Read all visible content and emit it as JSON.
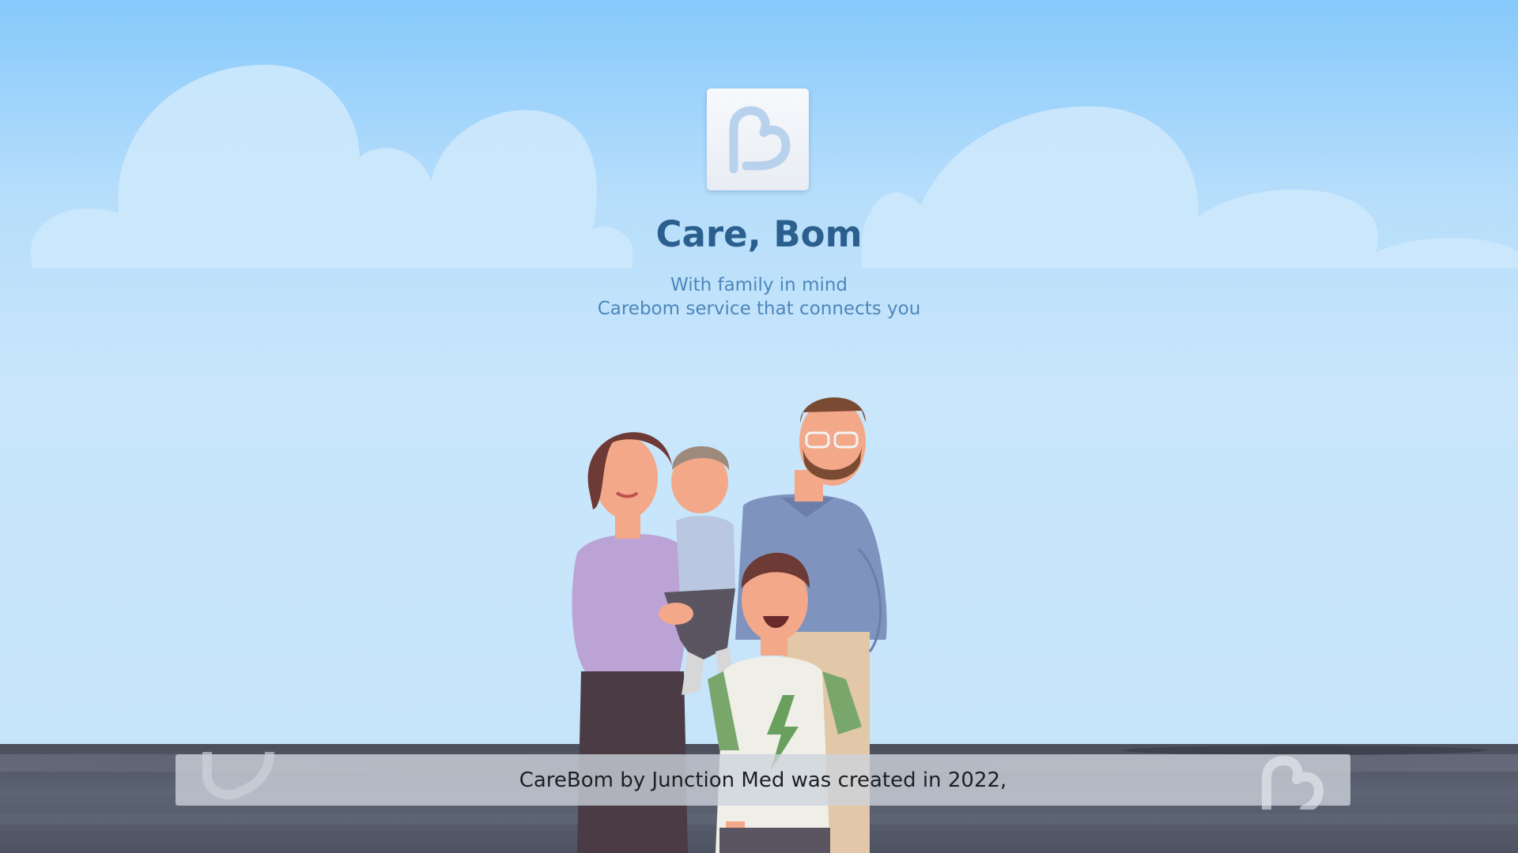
{
  "brand": {
    "logo_icon": "carebom-logo-icon",
    "title": "Care, Bom",
    "tagline_line1": "With family in mind",
    "tagline_line2": "Carebom service that connects you"
  },
  "illustration": {
    "subject": "family-illustration-icon"
  },
  "caption": {
    "text": "CareBom by Junction Med was created in 2022,"
  },
  "colors": {
    "sky_top": "#86c9fb",
    "sky_bottom": "#c6e4fa",
    "title": "#2a5f8e",
    "tagline": "#4c87bb",
    "ground": "#4d5361",
    "caption_bar": "#cdd3dc"
  }
}
